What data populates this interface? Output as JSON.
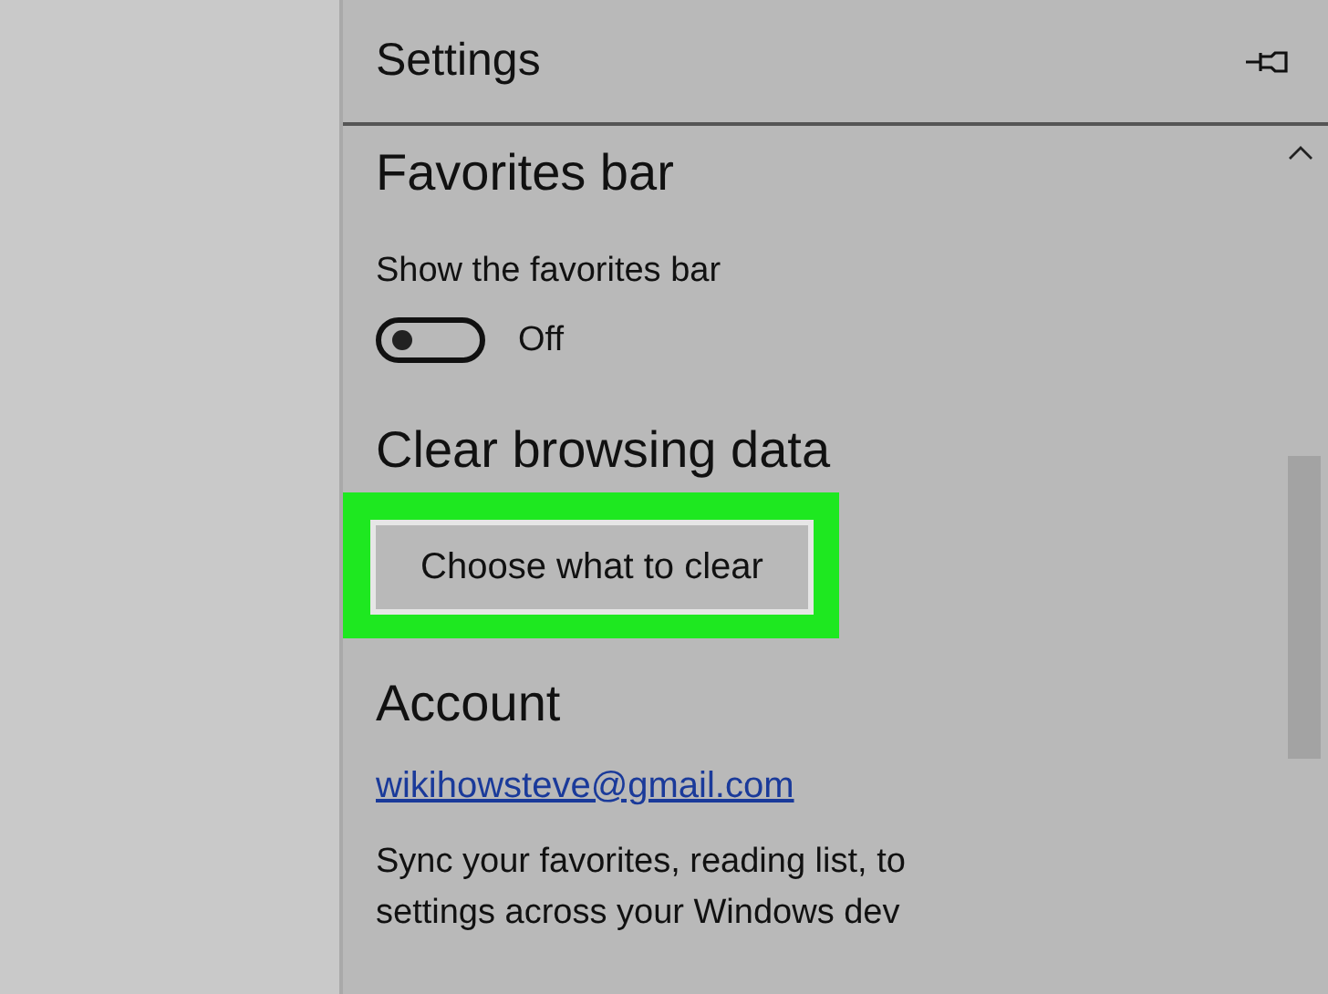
{
  "panel": {
    "title": "Settings"
  },
  "favorites_bar": {
    "heading": "Favorites bar",
    "toggle": {
      "label": "Show the favorites bar",
      "on": false,
      "state_text": "Off"
    }
  },
  "clear_browsing_data": {
    "heading": "Clear browsing data",
    "button": {
      "label": "Choose what to clear",
      "highlighted": true
    }
  },
  "account": {
    "heading": "Account",
    "email": "wikihowsteve@gmail.com",
    "description_lines": [
      "Sync your favorites, reading list, to",
      "settings across your Windows dev"
    ]
  }
}
